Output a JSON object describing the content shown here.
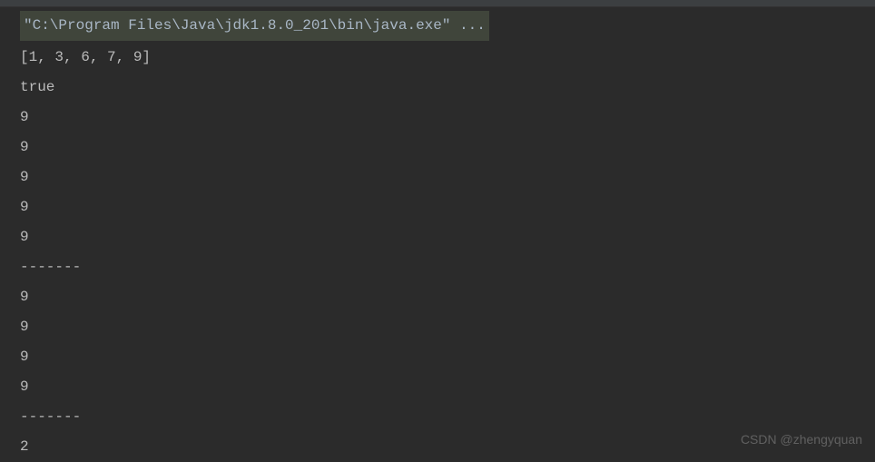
{
  "command": "\"C:\\Program Files\\Java\\jdk1.8.0_201\\bin\\java.exe\" ...",
  "output": {
    "lines": [
      "[1, 3, 6, 7, 9]",
      "true",
      "9",
      "9",
      "9",
      "9",
      "9",
      "-------",
      "9",
      "9",
      "9",
      "9",
      "-------",
      "2"
    ]
  },
  "watermark": "CSDN @zhengyquan"
}
